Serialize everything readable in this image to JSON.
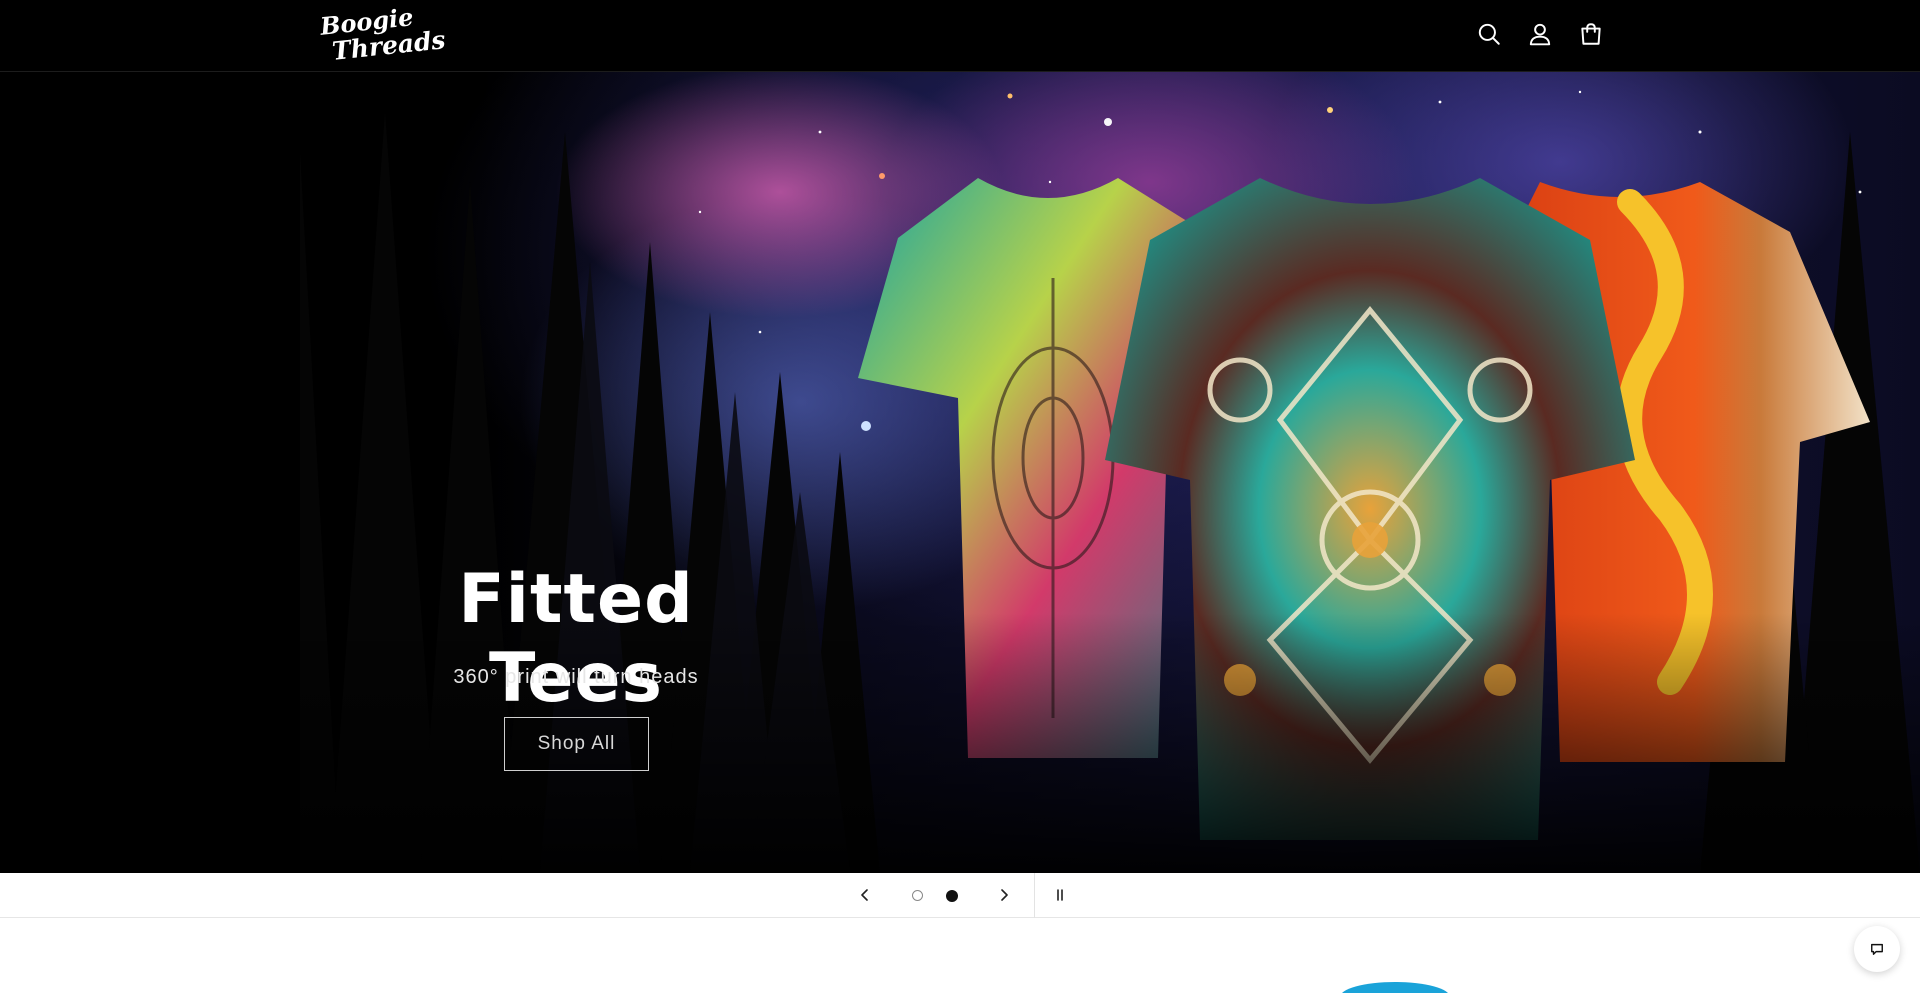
{
  "header": {
    "logo_line1": "Boogie",
    "logo_line2": "Threads",
    "icons": [
      "search-icon",
      "account-icon",
      "cart-icon"
    ]
  },
  "hero": {
    "title": "Fitted Tees",
    "subtitle": "360° print will turn heads",
    "button_label": "Shop All"
  },
  "slideshow": {
    "slide_count": 2,
    "active_slide": 2,
    "controls": [
      "chevron-left-icon",
      "chevron-right-icon",
      "pause-icon"
    ]
  },
  "colors": {
    "header_bg": "#000000",
    "hero_text": "#ffffff",
    "accent_orange": "#f05a1a",
    "accent_teal": "#1aa3a3"
  }
}
